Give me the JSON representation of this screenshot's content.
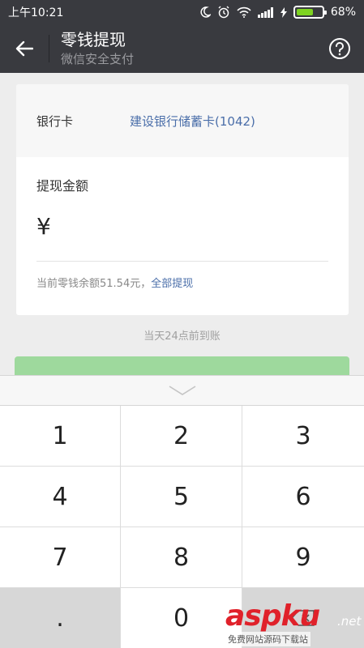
{
  "status_bar": {
    "time": "上午10:21",
    "battery": "68%",
    "battery_level": 0.68
  },
  "header": {
    "title": "零钱提现",
    "subtitle": "微信安全支付"
  },
  "card": {
    "bank_label": "银行卡",
    "bank_value": "建设银行储蓄卡(1042)",
    "amount_label": "提现金额",
    "currency": "¥",
    "amount_value": "",
    "balance_text": "当前零钱余额51.54元，",
    "withdraw_all": "全部提现"
  },
  "arrival_text": "当天24点前到账",
  "keypad": {
    "keys": [
      "1",
      "2",
      "3",
      "4",
      "5",
      "6",
      "7",
      "8",
      "9",
      ".",
      "0",
      ""
    ]
  },
  "watermark": {
    "brand": "asp",
    "brand_tail": "ku",
    "domain": ".net",
    "tagline": "免费网站源码下载站"
  },
  "colors": {
    "header_bg": "#393a3f",
    "link": "#4a6ea9",
    "button_green": "#9ed99d",
    "battery_green": "#7ed321"
  }
}
